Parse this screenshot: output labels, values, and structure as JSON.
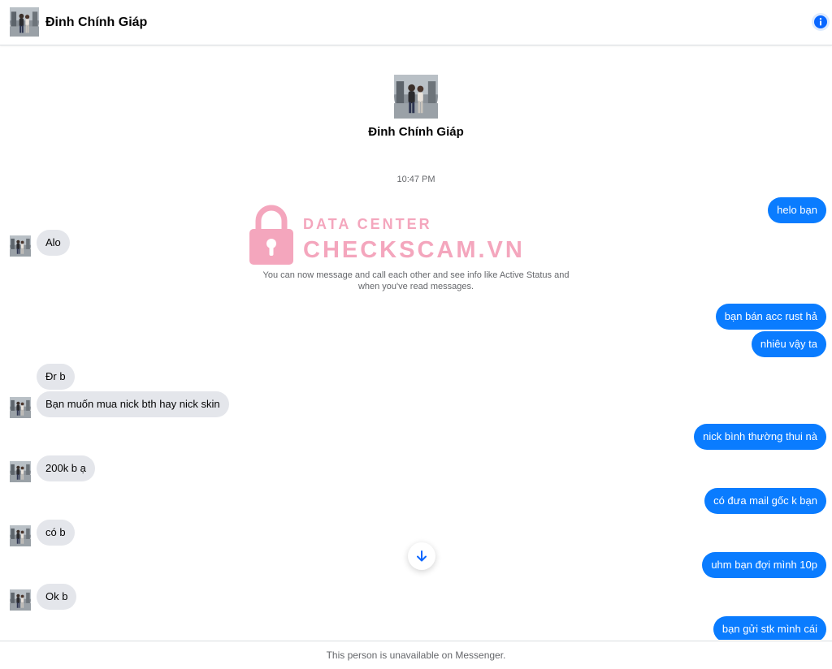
{
  "header": {
    "contact_name": "Đinh Chính Giáp",
    "info_icon": "info-icon"
  },
  "profile": {
    "name": "Đinh Chính Giáp"
  },
  "thread": {
    "timestamp": "10:47 PM",
    "system_note": "You can now message and call each other and see info like Active Status and when you've read messages."
  },
  "watermark": {
    "line1": "DATA CENTER",
    "line2": "CHECKSCAM.VN",
    "color": "#f4a6bd"
  },
  "messages": [
    {
      "direction": "out",
      "text": "helo bạn"
    },
    {
      "direction": "in",
      "text": "Alo"
    },
    {
      "direction": "out",
      "text": "bạn bán acc rust hả"
    },
    {
      "direction": "out",
      "text": "nhiêu vậy ta"
    },
    {
      "direction": "in",
      "text": "Đr b"
    },
    {
      "direction": "in",
      "text": "Bạn muốn mua nick bth hay nick skin"
    },
    {
      "direction": "out",
      "text": "nick bình thường thui nà"
    },
    {
      "direction": "in",
      "text": "200k b ạ"
    },
    {
      "direction": "out",
      "text": "có đưa mail gốc k bạn"
    },
    {
      "direction": "in",
      "text": "có b"
    },
    {
      "direction": "out",
      "text": "uhm bạn đợi mình 10p"
    },
    {
      "direction": "in",
      "text": "Ok b"
    },
    {
      "direction": "out",
      "text": "bạn gửi stk mình cái"
    }
  ],
  "footer": {
    "text": "This person is unavailable on Messenger."
  },
  "colors": {
    "outgoing_bubble": "#0a7cff",
    "incoming_bubble": "#e4e6eb",
    "accent": "#0866ff"
  }
}
